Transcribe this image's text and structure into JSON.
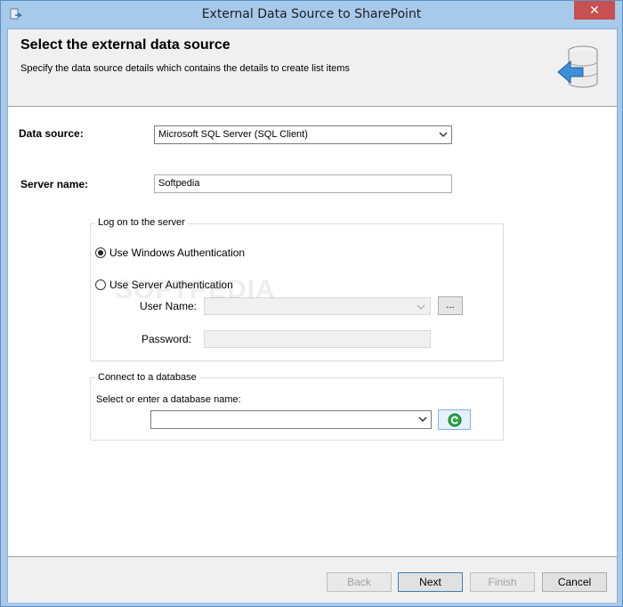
{
  "window": {
    "title": "External Data Source to SharePoint",
    "close_glyph": "✕"
  },
  "header": {
    "title": "Select the external data source",
    "subtitle": "Specify the data source details which contains the details to create list items"
  },
  "form": {
    "data_source_label": "Data source:",
    "data_source_value": "Microsoft SQL Server (SQL Client)",
    "server_name_label": "Server name:",
    "server_name_value": "Softpedia"
  },
  "logon": {
    "caption": "Log on to the server",
    "windows_auth_label": "Use Windows Authentication",
    "windows_auth_checked": true,
    "server_auth_label": "Use Server Authentication",
    "server_auth_checked": false,
    "username_label": "User Name:",
    "username_value": "",
    "browse_label": "...",
    "password_label": "Password:",
    "password_value": ""
  },
  "database": {
    "caption": "Connect to a database",
    "prompt": "Select or enter a database name:",
    "value": ""
  },
  "watermark": "SOFTPEDIA",
  "footer": {
    "back_label": "Back",
    "next_label": "Next",
    "finish_label": "Finish",
    "cancel_label": "Cancel"
  },
  "icons": {
    "app": "sharepoint-app-icon",
    "header": "database-import-icon",
    "refresh": "refresh-icon",
    "dropdown": "chevron-down-icon"
  },
  "colors": {
    "frame": "#a7c9ea",
    "close_button": "#c75050",
    "refresh_green": "#1e9b3c",
    "header_bg": "#f0f0f0"
  }
}
